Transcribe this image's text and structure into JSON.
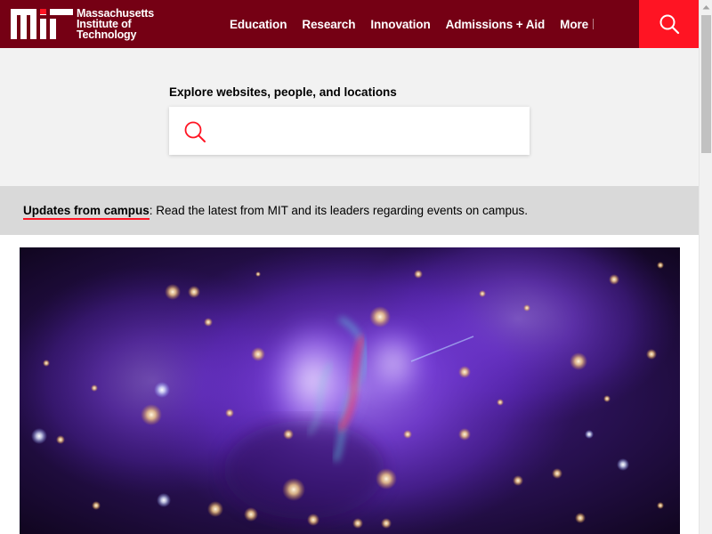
{
  "header": {
    "logo_lines": [
      "Massachusetts",
      "Institute of",
      "Technology"
    ],
    "nav": [
      "Education",
      "Research",
      "Innovation",
      "Admissions + Aid",
      "More"
    ],
    "colors": {
      "brand": "#750014",
      "accent": "#ff1423"
    },
    "search_icon": "search-icon"
  },
  "search": {
    "label": "Explore websites, people, and locations",
    "placeholder": "",
    "value": ""
  },
  "alert": {
    "link": "Updates from campus",
    "text": ": Read the latest from MIT and its leaders regarding events on campus."
  },
  "hero": {
    "image": "galaxy-cluster-image"
  }
}
